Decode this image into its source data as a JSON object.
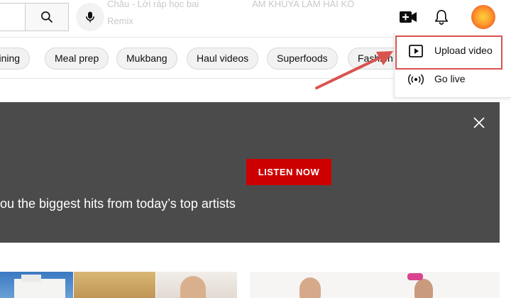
{
  "header": {
    "ghost_left_1": "Châu - Lời ráp học bai",
    "ghost_left_2": "Remix",
    "ghost_right": "ÂM KHUYA LẢM HẢI KÔ"
  },
  "chips": [
    "Training",
    "Meal prep",
    "Mukbang",
    "Haul videos",
    "Superfoods",
    "Fashion"
  ],
  "banner": {
    "button_label": "LISTEN NOW",
    "text": "ou the biggest hits from today’s top artists"
  },
  "menu": {
    "items": [
      {
        "label": "Upload video",
        "icon": "play-box-icon"
      },
      {
        "label": "Go live",
        "icon": "live-broadcast-icon"
      }
    ]
  },
  "colors": {
    "accent_red": "#cc0000",
    "banner_bg": "#4b4b4b",
    "annotation": "#d9534f"
  }
}
